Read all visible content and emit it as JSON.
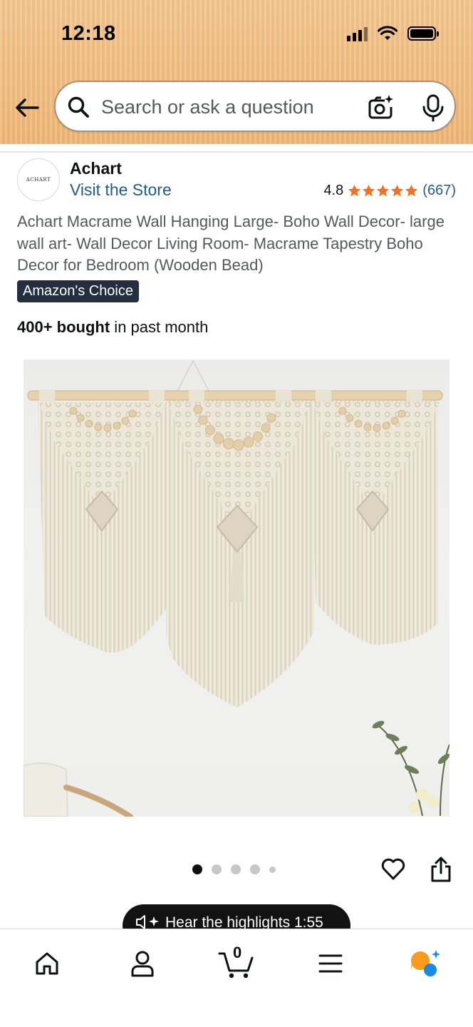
{
  "status_bar": {
    "time": "12:18"
  },
  "search": {
    "placeholder": "Search or ask a question"
  },
  "store": {
    "logo_text": "ACHART",
    "name": "Achart",
    "visit_label": "Visit the Store",
    "rating": "4.8",
    "stars": 5,
    "review_count": "(667)"
  },
  "product": {
    "title": "Achart Macrame Wall Hanging Large- Boho Wall Decor- large wall art- Wall Decor Living Room- Macrame Tapestry Boho Decor for Bedroom (Wooden Bead)",
    "badge": "Amazon's Choice",
    "bought_bold": "400+ bought",
    "bought_rest": " in past month",
    "image_count": 5,
    "active_image": 1
  },
  "audio": {
    "label": "Hear the highlights 1:55"
  },
  "bottom_nav": {
    "items": [
      "home-icon",
      "account-icon",
      "cart-icon",
      "menu-icon",
      "rufus-icon"
    ],
    "cart_count": "0"
  },
  "colors": {
    "header": "#f0b777",
    "link": "#1f5d8c",
    "star": "#f3701e",
    "badge": "#232f3e",
    "rufus_orange": "#f79b1c",
    "rufus_blue": "#1b8ae6"
  }
}
